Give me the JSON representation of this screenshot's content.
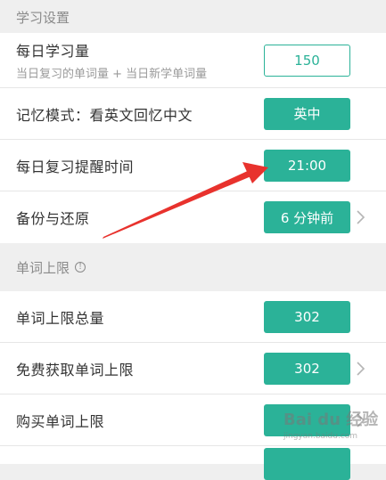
{
  "section1": {
    "title": "学习设置"
  },
  "rows1": [
    {
      "label": "每日学习量",
      "sublabel": "当日复习的单词量 + 当日新学单词量",
      "value": "150"
    },
    {
      "label": "记忆模式：看英文回忆中文",
      "value": "英中"
    },
    {
      "label": "每日复习提醒时间",
      "value": "21:00"
    },
    {
      "label": "备份与还原",
      "value": "6 分钟前"
    }
  ],
  "section2": {
    "title": "单词上限",
    "info_icon": "info-circle-icon"
  },
  "rows2": [
    {
      "label": "单词上限总量",
      "value": "302"
    },
    {
      "label": "免费获取单词上限",
      "value": "302"
    },
    {
      "label": "购买单词上限",
      "value": ""
    }
  ],
  "watermark": {
    "text": "Bai du 经验",
    "sub": "jingyan.baidu.com"
  },
  "colors": {
    "accent": "#2bb298",
    "annotation_arrow": "#e8322d",
    "background": "#efefef"
  }
}
